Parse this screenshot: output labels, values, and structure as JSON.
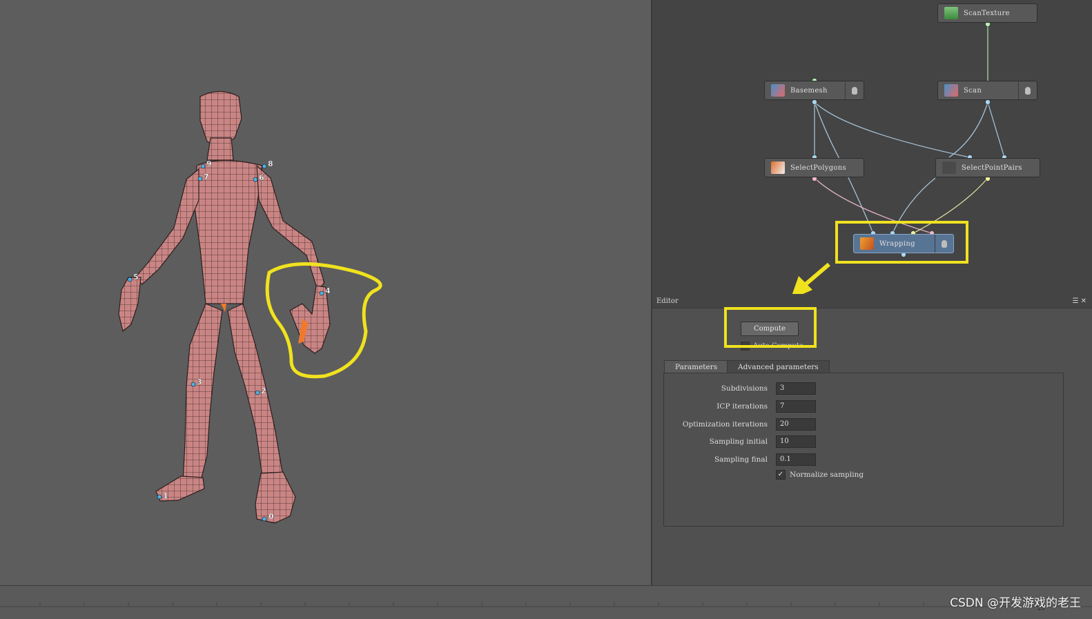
{
  "viewport": {
    "landmarks": [
      "0",
      "1",
      "2",
      "3",
      "4",
      "5",
      "6",
      "7",
      "8",
      "9"
    ]
  },
  "graph": {
    "nodes": {
      "scan_texture": "ScanTexture",
      "basemesh": "Basemesh",
      "scan": "Scan",
      "select_polygons": "SelectPolygons",
      "select_point_pairs": "SelectPointPairs",
      "wrapping": "Wrapping"
    }
  },
  "editor": {
    "title": "Editor",
    "compute_label": "Compute",
    "auto_compute_label": "Auto Compute",
    "tabs": [
      "Parameters",
      "Advanced parameters"
    ],
    "params": [
      {
        "label": "Subdivisions",
        "value": "3"
      },
      {
        "label": "ICP iterations",
        "value": "7"
      },
      {
        "label": "Optimization iterations",
        "value": "20"
      },
      {
        "label": "Sampling initial",
        "value": "10"
      },
      {
        "label": "Sampling final",
        "value": "0.1"
      }
    ],
    "normalize_label": "Normalize sampling",
    "normalize_checked": true
  },
  "timeline": {
    "frame": "25"
  },
  "watermark": "CSDN @开发游戏的老王",
  "colors": {
    "highlight": "#f0e21e",
    "selected_node": "#587494",
    "mesh": "#c47c7c",
    "landmark": "#4ab4e6"
  }
}
